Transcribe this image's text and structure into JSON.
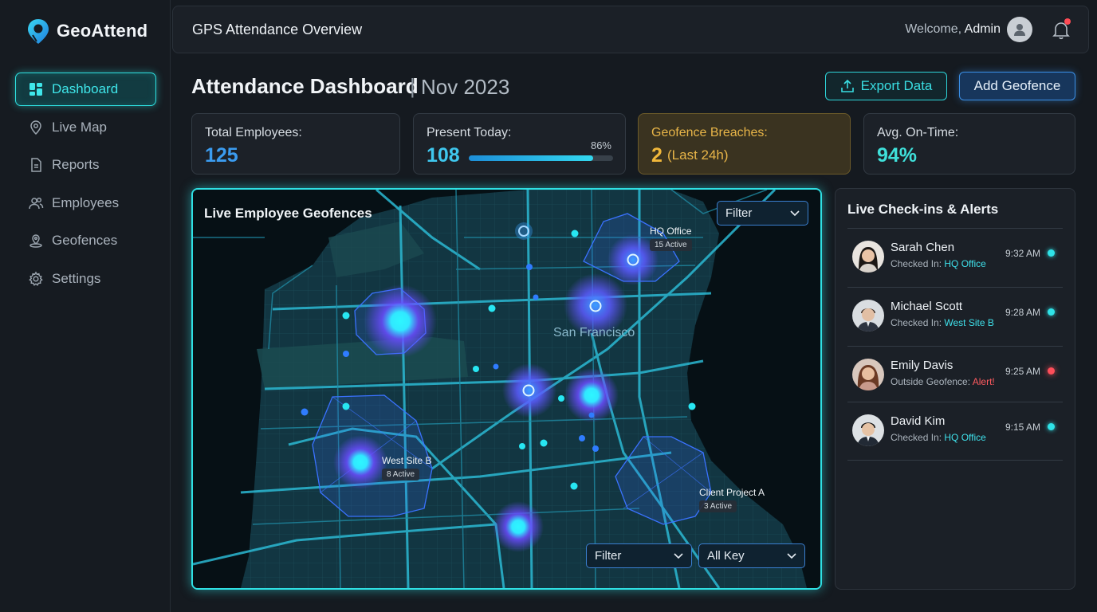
{
  "app": {
    "name": "GeoAttend"
  },
  "sidebar": {
    "items": [
      {
        "label": "Dashboard",
        "icon": "dashboard-icon",
        "active": true
      },
      {
        "label": "Live Map",
        "icon": "map-pin-icon",
        "active": false
      },
      {
        "label": "Reports",
        "icon": "document-icon",
        "active": false
      },
      {
        "label": "Employees",
        "icon": "users-icon",
        "active": false
      },
      {
        "label": "Geofences",
        "icon": "geofence-pin-icon",
        "active": false
      },
      {
        "label": "Settings",
        "icon": "gear-icon",
        "active": false
      }
    ]
  },
  "header": {
    "title": "GPS Attendance Overview",
    "welcome_prefix": "Welcome,",
    "user": "Admin",
    "notification_dot": true
  },
  "page": {
    "title": "Attendance Dashboard",
    "separator": "|",
    "month": "Nov 2023",
    "export_label": "Export Data",
    "add_label": "Add Geofence"
  },
  "stats": {
    "total": {
      "label": "Total Employees:",
      "value": "125"
    },
    "present": {
      "label": "Present Today:",
      "value": "108",
      "percent_text": "86%",
      "percent": 86
    },
    "breach": {
      "label": "Geofence Breaches:",
      "value": "2",
      "sub": "(Last 24h)"
    },
    "ontime": {
      "label": "Avg. On-Time:",
      "value": "94%"
    }
  },
  "map": {
    "title": "Live Employee Geofences",
    "filter_top": "Filter",
    "filter_bottom": "Filter",
    "key_select": "All Key",
    "city": "San Francisco",
    "geofences": [
      {
        "name": "HQ Office",
        "active": "15 Active"
      },
      {
        "name": "West Site B",
        "active": "8 Active"
      },
      {
        "name": "Client Project A",
        "active": "3 Active"
      }
    ]
  },
  "live": {
    "title": "Live Check-ins & Alerts",
    "items": [
      {
        "name": "Sarah Chen",
        "status_prefix": "Checked In:",
        "location": "HQ Office",
        "time": "9:32 AM",
        "state": "ok"
      },
      {
        "name": "Michael Scott",
        "status_prefix": "Checked In:",
        "location": "West Site B",
        "time": "9:28 AM",
        "state": "ok"
      },
      {
        "name": "Emily Davis",
        "status_prefix": "Outside Geofence:",
        "location": "Alert!",
        "time": "9:25 AM",
        "state": "alert"
      },
      {
        "name": "David Kim",
        "status_prefix": "Checked In:",
        "location": "HQ Office",
        "time": "9:15 AM",
        "state": "ok"
      }
    ]
  },
  "colors": {
    "accent_cyan": "#2fe0e4",
    "accent_blue": "#3a8fe6",
    "warning": "#f0b73a",
    "alert": "#ff4e5a"
  }
}
